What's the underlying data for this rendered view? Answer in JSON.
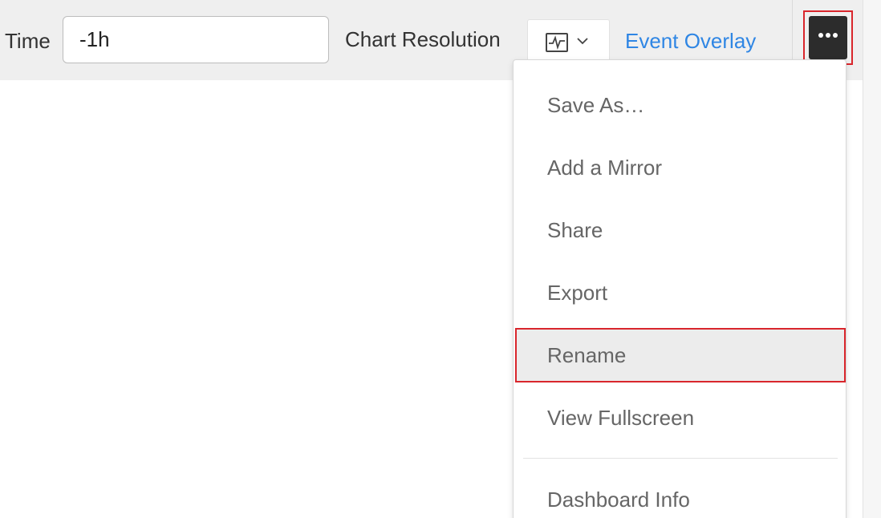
{
  "toolbar": {
    "time_label": "Time",
    "time_value": "-1h",
    "resolution_label": "Chart Resolution",
    "resolution_icon": "line-chart-icon",
    "event_overlay_label": "Event Overlay",
    "more_icon": "more-dots-icon"
  },
  "menu": {
    "items": [
      {
        "label": "Save As…"
      },
      {
        "label": "Add a Mirror"
      },
      {
        "label": "Share"
      },
      {
        "label": "Export"
      },
      {
        "label": "Rename",
        "highlighted": true
      },
      {
        "label": "View Fullscreen"
      },
      {
        "label": "Dashboard Info"
      }
    ]
  },
  "colors": {
    "accent_link": "#2f86e4",
    "highlight_outline": "#d9262c",
    "more_button_bg": "#2c2c2c"
  }
}
